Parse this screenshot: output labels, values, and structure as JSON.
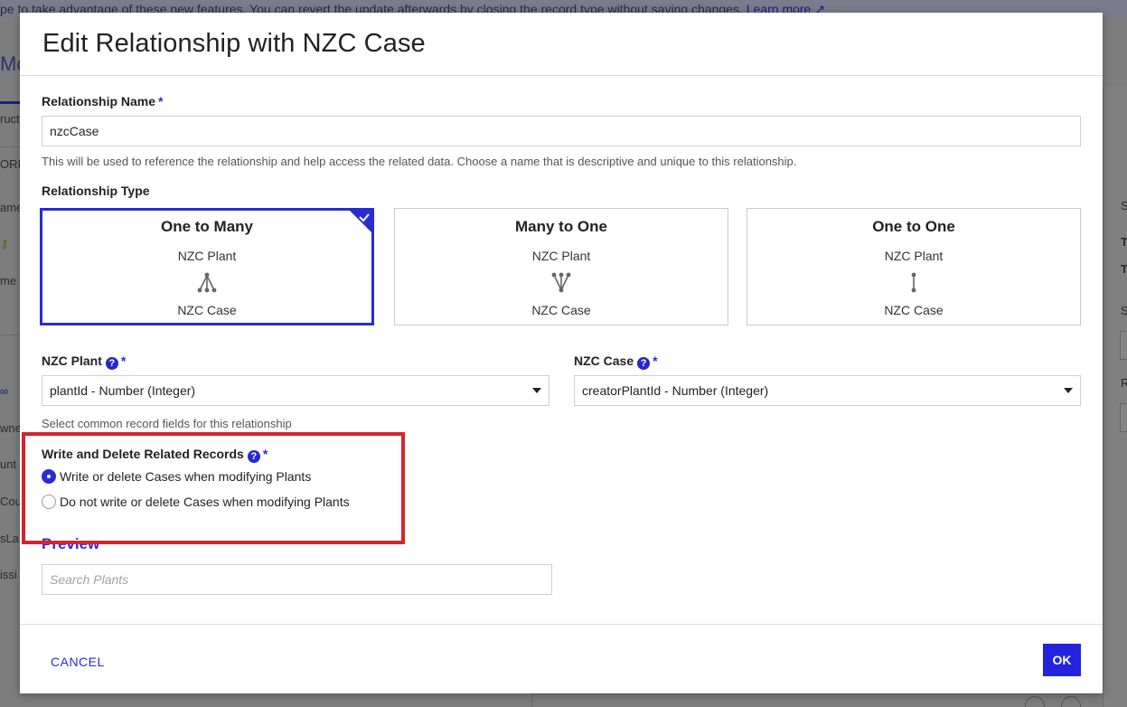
{
  "background": {
    "banner_text": "pe to take advantage of these new features. You can revert the update afterwards by closing the record type without saving changes.",
    "banner_link": "Learn more",
    "left_fragments": [
      "Mo",
      "ruct",
      "ORI",
      "ame",
      "me",
      "wne",
      "unt",
      "Cou",
      "sLa",
      "issi"
    ],
    "right_fragments": [
      "S",
      "T",
      "T",
      "S",
      "R"
    ]
  },
  "dialog": {
    "title": "Edit Relationship with NZC Case",
    "relationship_name": {
      "label": "Relationship Name",
      "required_mark": "*",
      "value": "nzcCase",
      "hint": "This will be used to reference the relationship and help access the related data. Choose a name that is descriptive and unique to this relationship."
    },
    "relationship_type": {
      "label": "Relationship Type",
      "options": [
        {
          "title": "One to Many",
          "top": "NZC Plant",
          "bottom": "NZC Case",
          "icon": "one-to-many-icon",
          "selected": true
        },
        {
          "title": "Many to One",
          "top": "NZC Plant",
          "bottom": "NZC Case",
          "icon": "many-to-one-icon",
          "selected": false
        },
        {
          "title": "One to One",
          "top": "NZC Plant",
          "bottom": "NZC Case",
          "icon": "one-to-one-icon",
          "selected": false
        }
      ]
    },
    "fields": {
      "left_label": "NZC Plant",
      "left_value": "plantId - Number (Integer)",
      "right_label": "NZC Case",
      "right_value": "creatorPlantId - Number (Integer)",
      "help_glyph": "?",
      "required_mark": "*",
      "hint": "Select common record fields for this relationship"
    },
    "write_delete": {
      "label": "Write and Delete Related Records",
      "required_mark": "*",
      "options": [
        {
          "label": "Write or delete Cases when modifying Plants",
          "selected": true
        },
        {
          "label": "Do not write or delete Cases when modifying Plants",
          "selected": false
        }
      ]
    },
    "preview": {
      "title": "Preview",
      "search_placeholder": "Search Plants"
    },
    "footer": {
      "cancel_label": "CANCEL",
      "ok_label": "OK"
    }
  },
  "colors": {
    "accent": "#2b2bd6",
    "ok_button": "#2323dd",
    "highlight": "#d7232e"
  }
}
